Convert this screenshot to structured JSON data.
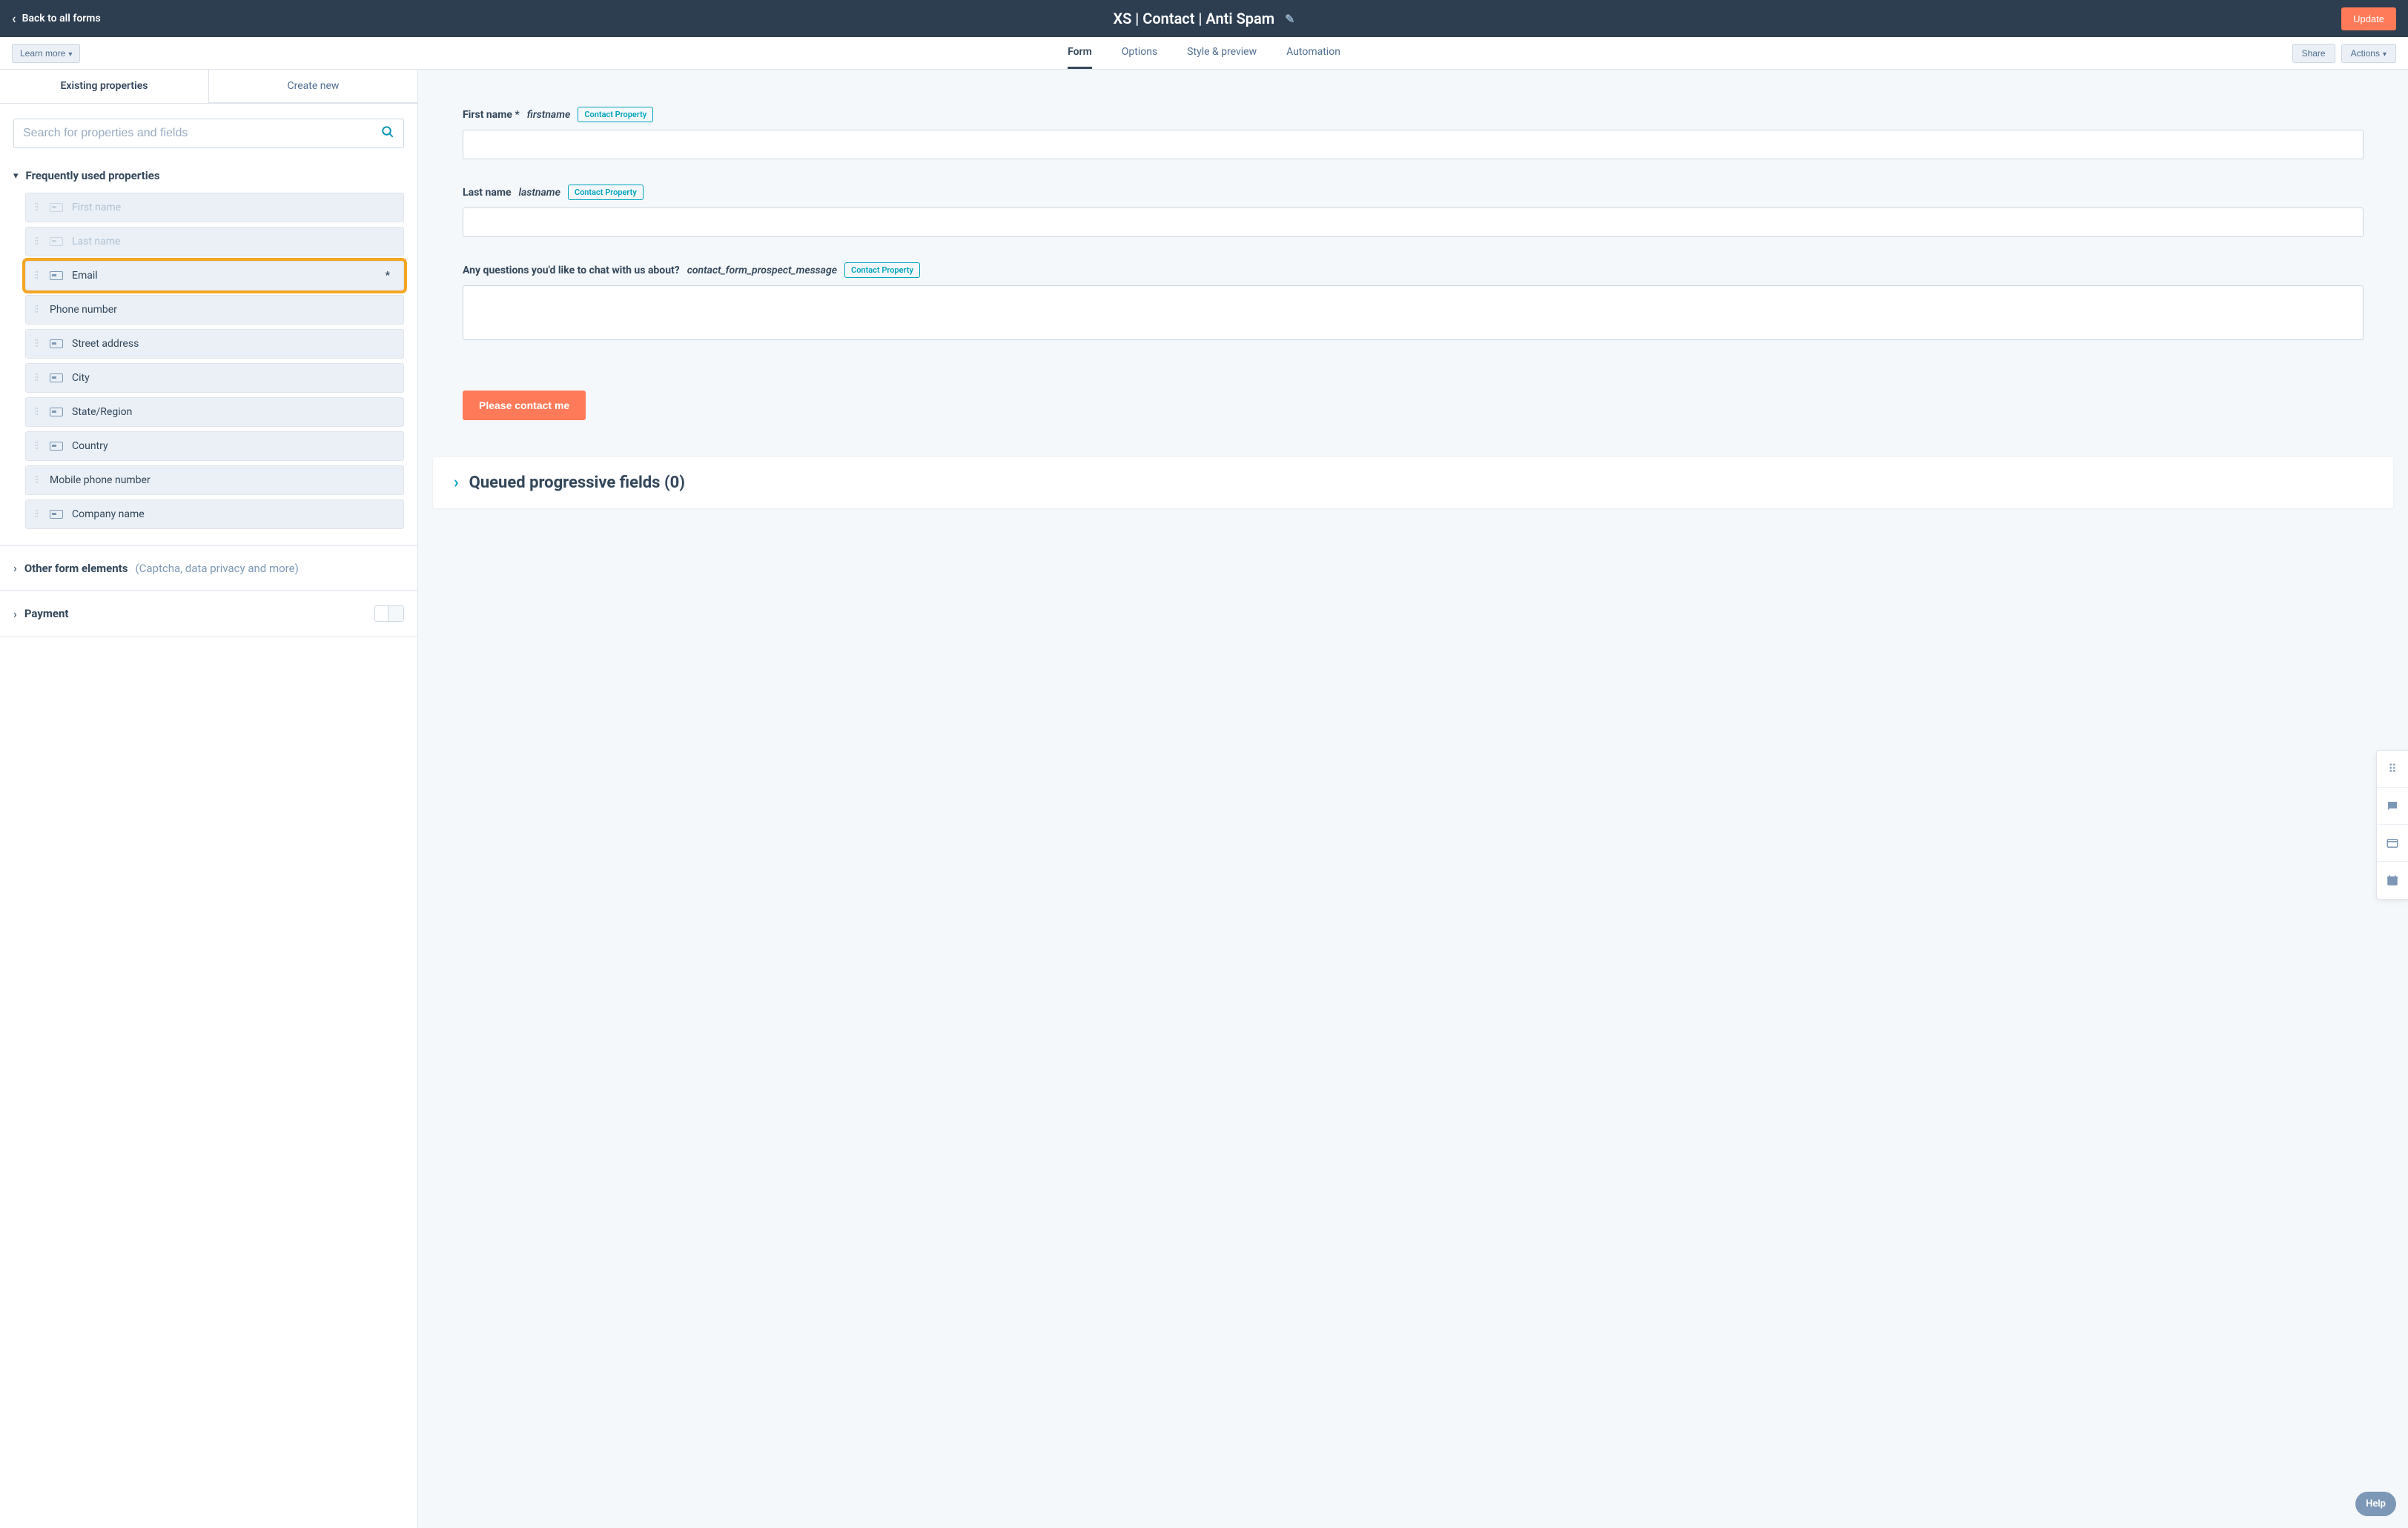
{
  "header": {
    "back_label": "Back to all forms",
    "title": "XS | Contact | Anti Spam",
    "update_label": "Update"
  },
  "secondary": {
    "learn_more": "Learn more",
    "tabs": [
      "Form",
      "Options",
      "Style & preview",
      "Automation"
    ],
    "active_tab": 0,
    "share": "Share",
    "actions": "Actions"
  },
  "left": {
    "tabs": [
      "Existing properties",
      "Create new"
    ],
    "active_tab": 0,
    "search_placeholder": "Search for properties and fields",
    "freq_title": "Frequently used properties",
    "properties": [
      {
        "label": "First name",
        "disabled": true,
        "highlighted": false,
        "required": false,
        "has_icon": true
      },
      {
        "label": "Last name",
        "disabled": true,
        "highlighted": false,
        "required": false,
        "has_icon": true
      },
      {
        "label": "Email",
        "disabled": false,
        "highlighted": true,
        "required": true,
        "has_icon": true
      },
      {
        "label": "Phone number",
        "disabled": false,
        "highlighted": false,
        "required": false,
        "has_icon": false
      },
      {
        "label": "Street address",
        "disabled": false,
        "highlighted": false,
        "required": false,
        "has_icon": true
      },
      {
        "label": "City",
        "disabled": false,
        "highlighted": false,
        "required": false,
        "has_icon": true
      },
      {
        "label": "State/Region",
        "disabled": false,
        "highlighted": false,
        "required": false,
        "has_icon": true
      },
      {
        "label": "Country",
        "disabled": false,
        "highlighted": false,
        "required": false,
        "has_icon": true
      },
      {
        "label": "Mobile phone number",
        "disabled": false,
        "highlighted": false,
        "required": false,
        "has_icon": false
      },
      {
        "label": "Company name",
        "disabled": false,
        "highlighted": false,
        "required": false,
        "has_icon": true
      }
    ],
    "other_title": "Other form elements",
    "other_subtitle": "(Captcha, data privacy and more)",
    "payment_title": "Payment"
  },
  "form_preview": {
    "fields": [
      {
        "label": "First name",
        "required": true,
        "internal": "firstname",
        "badge": "Contact Property",
        "type": "text"
      },
      {
        "label": "Last name",
        "required": false,
        "internal": "lastname",
        "badge": "Contact Property",
        "type": "text"
      },
      {
        "label": "Any questions you'd like to chat with us about?",
        "required": false,
        "internal": "contact_form_prospect_message",
        "badge": "Contact Property",
        "type": "textarea"
      }
    ],
    "submit_label": "Please contact me"
  },
  "queued": {
    "title": "Queued progressive fields (0)"
  },
  "help_label": "Help"
}
